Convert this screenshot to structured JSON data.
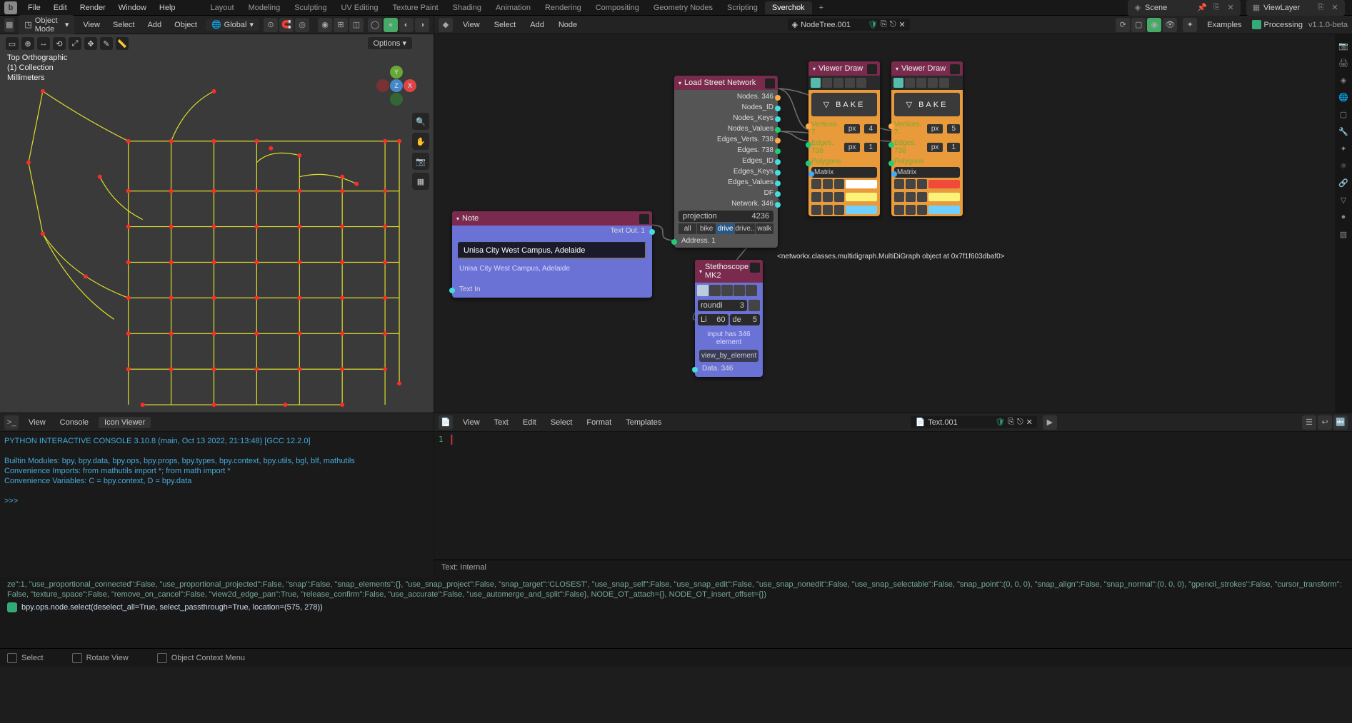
{
  "topbar": {
    "menus": [
      "File",
      "Edit",
      "Render",
      "Window",
      "Help"
    ],
    "workspaces": [
      "Layout",
      "Modeling",
      "Sculpting",
      "UV Editing",
      "Texture Paint",
      "Shading",
      "Animation",
      "Rendering",
      "Compositing",
      "Geometry Nodes",
      "Scripting",
      "Sverchok"
    ],
    "active_workspace": "Sverchok",
    "scene_label": "Scene",
    "viewlayer_label": "ViewLayer"
  },
  "viewport_header": {
    "mode": "Object Mode",
    "menus": [
      "View",
      "Select",
      "Add",
      "Object"
    ],
    "orientation": "Global"
  },
  "viewport": {
    "overlay_lines": [
      "Top Orthographic",
      "(1) Collection",
      "Millimeters"
    ],
    "options_label": "Options"
  },
  "node_header": {
    "menus": [
      "View",
      "Select",
      "Add",
      "Node"
    ],
    "tree_name": "NodeTree.001",
    "examples": "Examples",
    "processing": "Processing",
    "version": "v1.1.0-beta"
  },
  "nodes": {
    "note": {
      "title": "Note",
      "text": "Unisa City West Campus, Adelaide",
      "echo": "Unisa City West Campus, Adelaide",
      "out_label": "Text Out. 1",
      "in_label": "Text In"
    },
    "load": {
      "title": "Load Street Network",
      "outputs": [
        "Nodes. 346",
        "Nodes_ID",
        "Nodes_Keys",
        "Nodes_Values",
        "Edges_Verts. 738",
        "Edges. 738",
        "Edges_ID",
        "Edges_Keys",
        "Edges_Values",
        "DF",
        "Network. 346"
      ],
      "proj_label": "projection",
      "proj_value": "4236",
      "net_types": [
        "all",
        "bike",
        "drive",
        "drive..",
        "walk"
      ],
      "net_active": "drive",
      "addr_label": "Address. 1"
    },
    "viewer1": {
      "title": "Viewer Draw",
      "bake": "BAKE",
      "verts_label": "Vertices. 7.",
      "verts_px": "px",
      "verts_num": "4",
      "edges_label": "Edges. 738",
      "edges_px": "px",
      "edges_num": "1",
      "polys_label": "Polygons",
      "matrix_label": "Matrix"
    },
    "viewer2": {
      "title": "Viewer Draw",
      "bake": "BAKE",
      "verts_label": "Vertices. 7.",
      "verts_px": "px",
      "verts_num": "5",
      "edges_label": "Edges. 738",
      "edges_px": "px",
      "edges_num": "1",
      "polys_label": "Polygons",
      "matrix_label": "Matrix"
    },
    "steth": {
      "title": "Stethoscope MK2",
      "round_label": "roundi",
      "round_val": "3",
      "li_label": "Li",
      "li_val": "60",
      "de_label": "de",
      "de_val": "5",
      "info": "input has 346 element",
      "vbe": "view_by_element",
      "data_label": "Data. 346",
      "output": "<networkx.classes.multidigraph.MultiDiGraph object at 0x7f1f603dbaf0>"
    }
  },
  "console": {
    "header_menus": [
      "View",
      "Console",
      "Icon Viewer"
    ],
    "banner": "PYTHON INTERACTIVE CONSOLE 3.10.8 (main, Oct 13 2022, 21:13:48) [GCC 12.2.0]",
    "l1": "Builtin Modules:     bpy, bpy.data, bpy.ops, bpy.props, bpy.types, bpy.context, bpy.utils, bgl, blf, mathutils",
    "l2": "Convenience Imports: from mathutils import *; from math import *",
    "l3": "Convenience Variables: C = bpy.context, D = bpy.data",
    "prompt": ">>> "
  },
  "texteditor": {
    "header_menus": [
      "View",
      "Text",
      "Edit",
      "Select",
      "Format",
      "Templates"
    ],
    "text_name": "Text.001",
    "line_no": "1",
    "hint": "Text: Internal"
  },
  "log": {
    "dump": "ze\":1, \"use_proportional_connected\":False, \"use_proportional_projected\":False, \"snap\":False, \"snap_elements\":{}, \"use_snap_project\":False, \"snap_target\":'CLOSEST', \"use_snap_self\":False, \"use_snap_edit\":False, \"use_snap_nonedit\":False, \"use_snap_selectable\":False, \"snap_point\":(0, 0, 0), \"snap_align\":False, \"snap_normal\":(0, 0, 0), \"gpencil_strokes\":False, \"cursor_transform\":False, \"texture_space\":False, \"remove_on_cancel\":False, \"view2d_edge_pan\":True, \"release_confirm\":False, \"use_accurate\":False, \"use_automerge_and_split\":False}, NODE_OT_attach={}, NODE_OT_insert_offset={})",
    "cmd": "bpy.ops.node.select(deselect_all=True, select_passthrough=True, location=(575, 278))"
  },
  "statusbar": {
    "select": "Select",
    "rotate": "Rotate View",
    "ctx": "Object Context Menu"
  }
}
